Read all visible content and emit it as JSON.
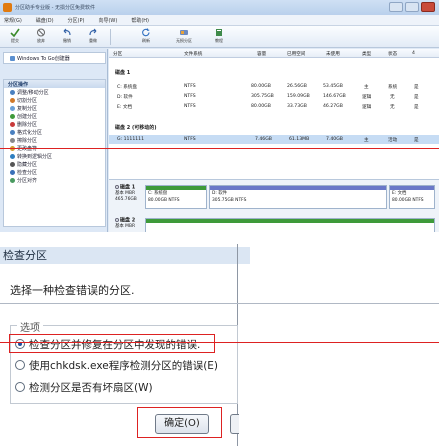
{
  "window": {
    "title": "分区助手专业版 - 无损分区免费软件",
    "menu": [
      "常规(G)",
      "磁盘(D)",
      "分区(P)",
      "向导(W)",
      "帮助(H)"
    ]
  },
  "toolbar": {
    "buttons": [
      "提交",
      "放弃",
      "撤销",
      "重做",
      "刷新",
      "无损分区",
      "教程"
    ]
  },
  "sidebar": {
    "wizard_item": "Windows To Go创建器",
    "ops_header": "分区操作",
    "ops": [
      "调整/移动分区",
      "切割分区",
      "复制分区",
      "创建分区",
      "删除分区",
      "格式化分区",
      "擦除分区",
      "更改盘符",
      "转换到逻辑分区",
      "隐藏分区",
      "检查分区",
      "分区对齐"
    ]
  },
  "table": {
    "headers": [
      "分区",
      "文件系统",
      "容量",
      "已用空间",
      "未使用",
      "类型",
      "状态",
      "4"
    ],
    "disk1_label": "磁盘 1",
    "disk1_rows": [
      [
        "C: 系统盘",
        "NTFS",
        "80.00GB",
        "26.56GB",
        "53.45GB",
        "主",
        "系统",
        "是"
      ],
      [
        "D: 软件",
        "NTFS",
        "305.75GB",
        "159.09GB",
        "146.67GB",
        "逻辑",
        "无",
        "是"
      ],
      [
        "E: 文档",
        "NTFS",
        "80.00GB",
        "33.73GB",
        "46.27GB",
        "逻辑",
        "无",
        "是"
      ]
    ],
    "disk2_label": "磁盘 2 (可移动的)",
    "disk2_rows": [
      [
        "G: 1111111",
        "NTFS",
        "7.46GB",
        "61.13MB",
        "7.40GB",
        "主",
        "活动",
        "是"
      ]
    ]
  },
  "disk_map": {
    "disk1": {
      "name": "磁盘 1",
      "type": "基本 MBR",
      "size": "465.76GB",
      "partitions": [
        {
          "label": "C: 系统盘",
          "size": "80.00GB NTFS",
          "color": "#3e9a3a"
        },
        {
          "label": "D: 软件",
          "size": "305.75GB NTFS",
          "color": "#6a78c8"
        },
        {
          "label": "E: 文档",
          "size": "80.00GB NTFS",
          "color": "#6a78c8"
        }
      ]
    },
    "disk2": {
      "name": "磁盘 2",
      "type": "基本 MBR"
    }
  },
  "dialog": {
    "title": "检查分区",
    "prompt": "选择一种检查错误的分区.",
    "group_label": "选项",
    "options": [
      "检查分区并修复在分区中发现的错误.",
      "使用chkdsk.exe程序检测分区的错误(E)",
      "检测分区是否有坏扇区(W)"
    ],
    "selected_option_index": 0,
    "ok_label": "确定(O)"
  },
  "colors": {
    "annotation": "#dd2222",
    "system_partition": "#3e9a3a",
    "logical_partition": "#6a78c8",
    "selection": "#c6dcf4"
  }
}
